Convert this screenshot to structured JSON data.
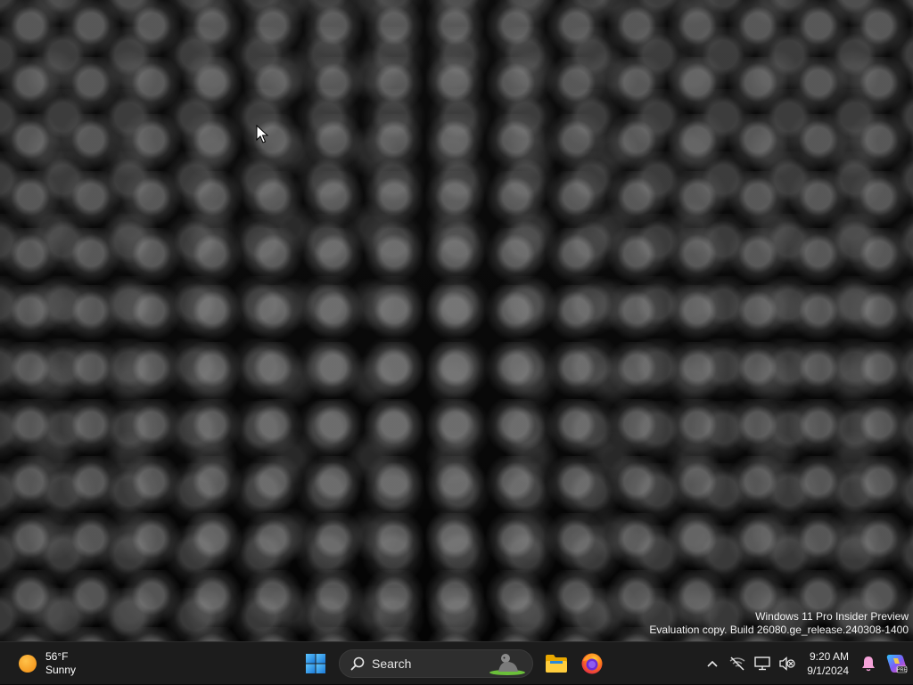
{
  "desktop": {
    "wallpaper": "skull-wall-icon"
  },
  "watermark": {
    "line1": "Windows 11 Pro Insider Preview",
    "line2": "Evaluation copy. Build 26080.ge_release.240308-1400"
  },
  "taskbar": {
    "weather": {
      "temperature": "56°F",
      "condition": "Sunny",
      "icon": "sun-icon"
    },
    "start_icon": "windows-logo-icon",
    "search": {
      "label": "Search",
      "icon": "search-icon"
    },
    "pinned": [
      {
        "name": "file-explorer-icon"
      },
      {
        "name": "firefox-icon"
      }
    ],
    "tray": {
      "icons": [
        "chevron-up-icon",
        "network-off-icon",
        "display-icon",
        "volume-muted-icon"
      ],
      "time": "9:20 AM",
      "date": "9/1/2024",
      "notification_icon": "bell-icon",
      "copilot_icon": "copilot-icon"
    }
  },
  "colors": {
    "taskbar_bg": "#1c1c1c",
    "accent_blue": "#2b88d8",
    "sun_orange": "#f39a17"
  }
}
